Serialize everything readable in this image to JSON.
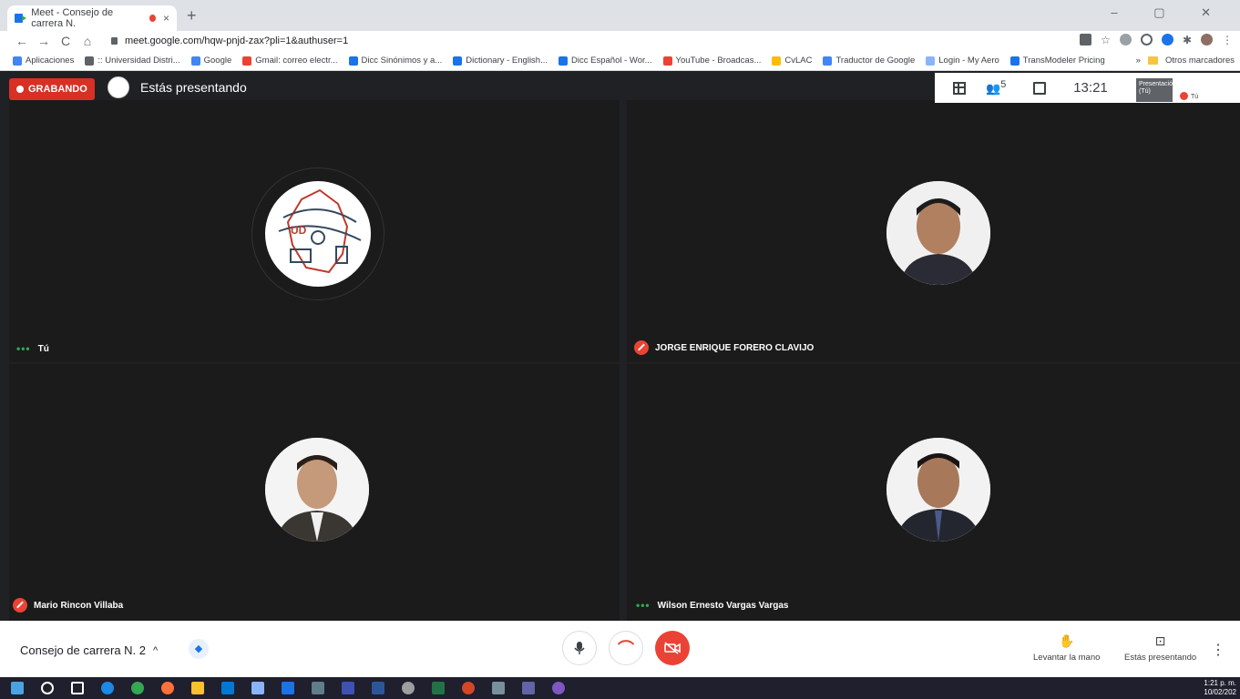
{
  "browser": {
    "tab_title": "Meet - Consejo de carrera N.",
    "tab_close": "×",
    "new_tab": "+",
    "window_controls": "–  ▢  ✕",
    "url": "meet.google.com/hqw-pnjd-zax?pli=1&authuser=1",
    "nav": {
      "back": "←",
      "forward": "→",
      "reload": "C",
      "home": "⌂"
    },
    "bookmarks": [
      {
        "label": "Aplicaciones",
        "color": "#4285f4"
      },
      {
        "label": ":: Universidad Distri...",
        "color": "#5f6368"
      },
      {
        "label": "Google",
        "color": "#4285f4"
      },
      {
        "label": "Gmail: correo electr...",
        "color": "#ea4335"
      },
      {
        "label": "Dicc Sinónimos y a...",
        "color": "#1a73e8"
      },
      {
        "label": "Dictionary - English...",
        "color": "#1a73e8"
      },
      {
        "label": "Dicc Español - Wor...",
        "color": "#1a73e8"
      },
      {
        "label": "YouTube - Broadcas...",
        "color": "#ea4335"
      },
      {
        "label": "CvLAC",
        "color": "#fbbc04"
      },
      {
        "label": "Traductor de Google",
        "color": "#4285f4"
      },
      {
        "label": "Login - My Aero",
        "color": "#8ab4f8"
      },
      {
        "label": "TransModeler Pricing",
        "color": "#1a73e8"
      }
    ],
    "bookmarks_more": "»",
    "other_bookmarks": "Otros marcadores"
  },
  "meet": {
    "recording_label": "GRABANDO",
    "presenting_label": "Estás presentando",
    "clock": "13:21",
    "people_count": "5",
    "presentation_thumb": "Presentación (Tú)",
    "you_thumb": "Tú",
    "tiles": [
      {
        "name": "Tú",
        "status": "speaking"
      },
      {
        "name": "JORGE ENRIQUE FORERO CLAVIJO",
        "status": "muted"
      },
      {
        "name": "Mario Rincon Villaba",
        "status": "muted"
      },
      {
        "name": "Wilson Ernesto Vargas Vargas",
        "status": "speaking"
      }
    ],
    "logo_text": "UD",
    "meeting_name": "Consejo de carrera N. 2",
    "meeting_chevron": "^",
    "raise_hand": "Levantar la mano",
    "presenting_button": "Estás presentando",
    "more_options": "⋮"
  },
  "colors": {
    "record_red": "#d93025",
    "mute_red": "#ea4335",
    "speaking_green": "#34a853",
    "meet_bg": "#202124"
  },
  "taskbar": {
    "time": "1:21 p. m.",
    "date": "10/02/202"
  }
}
